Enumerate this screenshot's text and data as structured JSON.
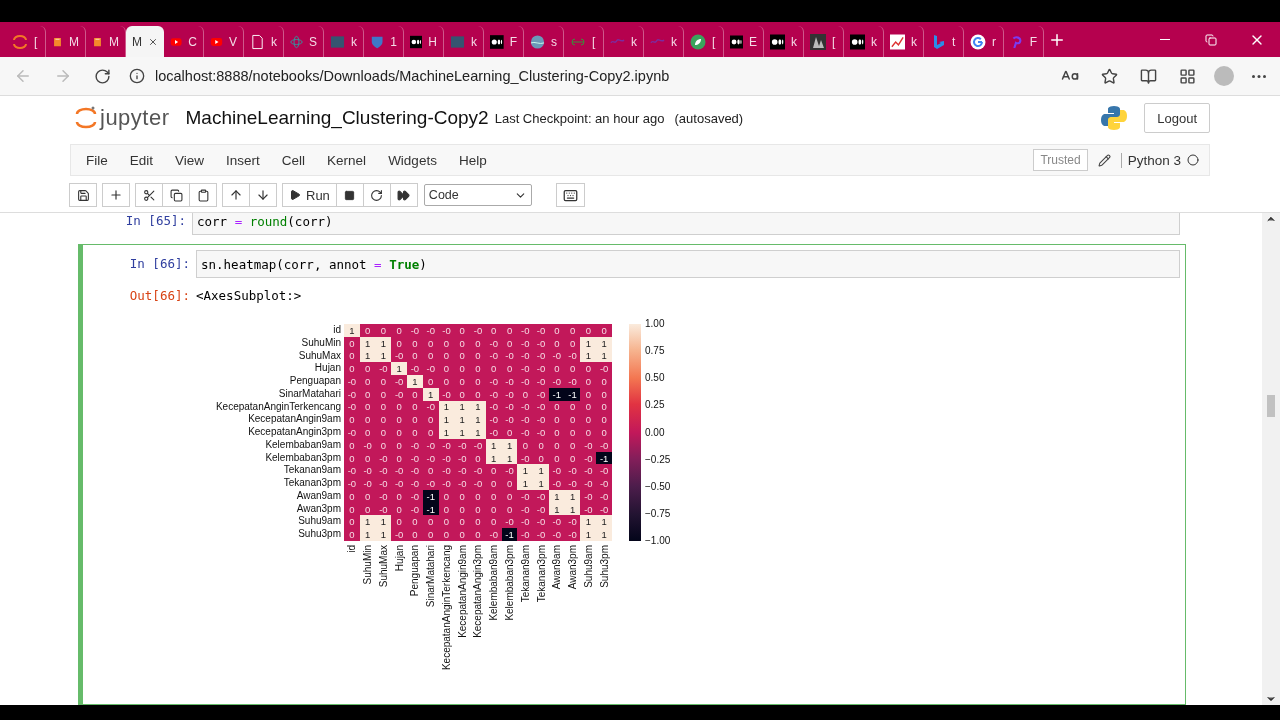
{
  "browser": {
    "tabs": [
      {
        "kind": "jupyter",
        "label": "[",
        "selected": false
      },
      {
        "kind": "book",
        "label": "M",
        "selected": false
      },
      {
        "kind": "book",
        "label": "M",
        "selected": false
      },
      {
        "kind": "plain",
        "label": "M",
        "selected": true
      },
      {
        "kind": "youtube",
        "label": "C",
        "selected": false
      },
      {
        "kind": "youtube",
        "label": "V",
        "selected": false
      },
      {
        "kind": "page",
        "label": "k",
        "selected": false
      },
      {
        "kind": "atom",
        "label": "S",
        "selected": false
      },
      {
        "kind": "tds",
        "label": "k",
        "selected": false
      },
      {
        "kind": "shield",
        "label": "1",
        "selected": false
      },
      {
        "kind": "medium",
        "label": "H",
        "selected": false
      },
      {
        "kind": "tds",
        "label": "k",
        "selected": false
      },
      {
        "kind": "medium",
        "label": "F",
        "selected": false
      },
      {
        "kind": "globe",
        "label": "s",
        "selected": false
      },
      {
        "kind": "gfg",
        "label": "[",
        "selected": false
      },
      {
        "kind": "scribble",
        "label": "k",
        "selected": false
      },
      {
        "kind": "scribble",
        "label": "k",
        "selected": false
      },
      {
        "kind": "leaf",
        "label": "[",
        "selected": false
      },
      {
        "kind": "medium",
        "label": "E",
        "selected": false
      },
      {
        "kind": "medium",
        "label": "k",
        "selected": false
      },
      {
        "kind": "image",
        "label": "[",
        "selected": false
      },
      {
        "kind": "medium",
        "label": "k",
        "selected": false
      },
      {
        "kind": "chart",
        "label": "k",
        "selected": false
      },
      {
        "kind": "bing",
        "label": "t",
        "selected": false
      },
      {
        "kind": "google",
        "label": "r",
        "selected": false
      },
      {
        "kind": "swirl",
        "label": "F",
        "selected": false
      }
    ],
    "url": "localhost:8888/notebooks/Downloads/MachineLearning_Clustering-Copy2.ipynb"
  },
  "header": {
    "logo": "jupyter",
    "title": "MachineLearning_Clustering-Copy2",
    "checkpoint": "Last Checkpoint: an hour ago",
    "autosave": "(autosaved)",
    "logout": "Logout"
  },
  "menu": [
    "File",
    "Edit",
    "View",
    "Insert",
    "Cell",
    "Kernel",
    "Widgets",
    "Help"
  ],
  "trusted": "Trusted",
  "kernel": "Python 3",
  "toolbar": {
    "run": "Run",
    "cell_type": "Code"
  },
  "cells": [
    {
      "selected": false,
      "prompt": "In [65]:",
      "code": [
        {
          "text": "corr ",
          "kind": "name"
        },
        {
          "text": "= ",
          "kind": "op"
        },
        {
          "text": "round",
          "kind": "builtin"
        },
        {
          "text": "(corr)",
          "kind": "name"
        }
      ]
    },
    {
      "selected": true,
      "prompt": "In [66]:",
      "code": [
        {
          "text": "sn.heatmap(corr, annot ",
          "kind": "name"
        },
        {
          "text": "= ",
          "kind": "op"
        },
        {
          "text": "True",
          "kind": "keyword"
        },
        {
          "text": ")",
          "kind": "name"
        }
      ],
      "output": {
        "prompt": "Out[66]:",
        "text": "<AxesSubplot:>",
        "heatmap": {
          "row_labels": [
            "id",
            "SuhuMin",
            "SuhuMax",
            "Hujan",
            "Penguapan",
            "SinarMatahari",
            "KecepatanAnginTerkencang",
            "KecepatanAngin9am",
            "KecepatanAngin3pm",
            "Kelembaban9am",
            "Kelembaban3pm",
            "Tekanan9am",
            "Tekanan3pm",
            "Awan9am",
            "Awan3pm",
            "Suhu9am",
            "Suhu3pm"
          ],
          "column_labels": [
            "id",
            "SuhuMin",
            "SuhuMax",
            "Hujan",
            "Penguapan",
            "SinarMatahari",
            "KecepatanAnginTerkencang",
            "KecepatanAngin9am",
            "KecepatanAngin3pm",
            "Kelembaban9am",
            "Kelembaban3pm",
            "Tekanan9am",
            "Tekanan3pm",
            "Awan9am",
            "Awan3pm",
            "Suhu9am",
            "Suhu3pm"
          ],
          "cells": [
            [
              "1",
              "0",
              "0",
              "0",
              "-0",
              "-0",
              "-0",
              "0",
              "-0",
              "0",
              "0",
              "-0",
              "-0",
              "0",
              "0",
              "0",
              "0"
            ],
            [
              "0",
              "1",
              "1",
              "0",
              "0",
              "0",
              "0",
              "0",
              "0",
              "-0",
              "0",
              "-0",
              "-0",
              "0",
              "0",
              "1",
              "1"
            ],
            [
              "0",
              "1",
              "1",
              "-0",
              "0",
              "0",
              "0",
              "0",
              "0",
              "-0",
              "-0",
              "-0",
              "-0",
              "-0",
              "-0",
              "1",
              "1"
            ],
            [
              "0",
              "0",
              "-0",
              "1",
              "-0",
              "-0",
              "0",
              "0",
              "0",
              "0",
              "0",
              "-0",
              "-0",
              "0",
              "0",
              "0",
              "-0"
            ],
            [
              "-0",
              "0",
              "0",
              "-0",
              "1",
              "0",
              "0",
              "0",
              "0",
              "-0",
              "-0",
              "-0",
              "-0",
              "-0",
              "-0",
              "0",
              "0"
            ],
            [
              "-0",
              "0",
              "0",
              "-0",
              "0",
              "1",
              "-0",
              "0",
              "0",
              "-0",
              "-0",
              "0",
              "-0",
              "-1",
              "-1",
              "0",
              "0"
            ],
            [
              "-0",
              "0",
              "0",
              "0",
              "0",
              "-0",
              "1",
              "1",
              "1",
              "-0",
              "-0",
              "-0",
              "-0",
              "0",
              "0",
              "0",
              "0"
            ],
            [
              "0",
              "0",
              "0",
              "0",
              "0",
              "0",
              "1",
              "1",
              "1",
              "-0",
              "-0",
              "-0",
              "-0",
              "0",
              "0",
              "0",
              "0"
            ],
            [
              "-0",
              "0",
              "0",
              "0",
              "0",
              "0",
              "1",
              "1",
              "1",
              "-0",
              "0",
              "-0",
              "-0",
              "0",
              "0",
              "0",
              "0"
            ],
            [
              "0",
              "-0",
              "0",
              "0",
              "-0",
              "-0",
              "-0",
              "-0",
              "-0",
              "1",
              "1",
              "0",
              "0",
              "0",
              "0",
              "-0",
              "-0"
            ],
            [
              "0",
              "0",
              "-0",
              "0",
              "-0",
              "-0",
              "-0",
              "-0",
              "0",
              "1",
              "1",
              "-0",
              "0",
              "0",
              "0",
              "-0",
              "-1"
            ],
            [
              "-0",
              "-0",
              "-0",
              "-0",
              "-0",
              "0",
              "-0",
              "-0",
              "-0",
              "0",
              "-0",
              "1",
              "1",
              "-0",
              "-0",
              "-0",
              "-0"
            ],
            [
              "-0",
              "-0",
              "-0",
              "-0",
              "-0",
              "-0",
              "-0",
              "-0",
              "-0",
              "0",
              "0",
              "1",
              "1",
              "-0",
              "-0",
              "-0",
              "-0"
            ],
            [
              "0",
              "0",
              "-0",
              "0",
              "-0",
              "-1",
              "0",
              "0",
              "0",
              "0",
              "0",
              "-0",
              "-0",
              "1",
              "1",
              "-0",
              "-0"
            ],
            [
              "0",
              "0",
              "-0",
              "0",
              "-0",
              "-1",
              "0",
              "0",
              "0",
              "0",
              "0",
              "-0",
              "-0",
              "1",
              "1",
              "-0",
              "-0"
            ],
            [
              "0",
              "1",
              "1",
              "0",
              "0",
              "0",
              "0",
              "0",
              "0",
              "0",
              "-0",
              "-0",
              "-0",
              "-0",
              "-0",
              "1",
              "1"
            ],
            [
              "0",
              "1",
              "1",
              "-0",
              "0",
              "0",
              "0",
              "0",
              "0",
              "-0",
              "-1",
              "-0",
              "-0",
              "-0",
              "-0",
              "1",
              "1"
            ]
          ],
          "colorbar_ticks": [
            "1.00",
            "0.75",
            "0.50",
            "0.25",
            "0.00",
            "−0.25",
            "−0.50",
            "−0.75",
            "−1.00"
          ]
        }
      }
    }
  ]
}
